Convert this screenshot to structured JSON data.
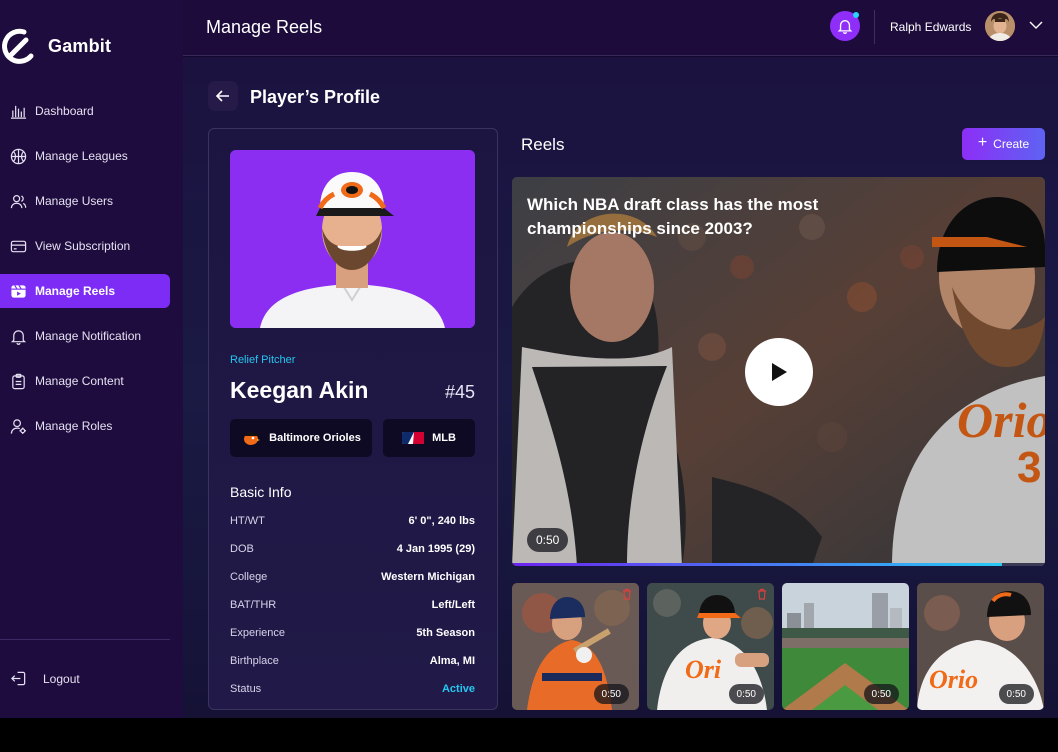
{
  "app": {
    "name": "Gambit"
  },
  "header": {
    "title": "Manage Reels",
    "user_name": "Ralph Edwards"
  },
  "sidebar": {
    "items": [
      {
        "label": "Dashboard",
        "icon": "bar-chart-icon",
        "active": false
      },
      {
        "label": "Manage Leagues",
        "icon": "basketball-icon",
        "active": false
      },
      {
        "label": "Manage Users",
        "icon": "users-icon",
        "active": false
      },
      {
        "label": "View Subscription",
        "icon": "credit-card-icon",
        "active": false
      },
      {
        "label": "Manage Reels",
        "icon": "reels-icon",
        "active": true
      },
      {
        "label": "Manage Notification",
        "icon": "bell-icon",
        "active": false
      },
      {
        "label": "Manage Content",
        "icon": "clipboard-icon",
        "active": false
      },
      {
        "label": "Manage Roles",
        "icon": "user-cog-icon",
        "active": false
      }
    ],
    "logout_label": "Logout"
  },
  "profile": {
    "section_title": "Player’s Profile",
    "position": "Relief Pitcher",
    "name": "Keegan Akin",
    "number": "#45",
    "team": "Baltimore Orioles",
    "league": "MLB",
    "basic_info_title": "Basic Info",
    "info": [
      {
        "label": "HT/WT",
        "value": "6' 0\", 240 lbs"
      },
      {
        "label": "DOB",
        "value": "4 Jan 1995 (29)"
      },
      {
        "label": "College",
        "value": "Western Michigan"
      },
      {
        "label": "BAT/THR",
        "value": "Left/Left"
      },
      {
        "label": "Experience",
        "value": "5th Season"
      },
      {
        "label": "Birthplace",
        "value": "Alma, MI"
      },
      {
        "label": "Status",
        "value": "Active"
      }
    ]
  },
  "reels": {
    "title": "Reels",
    "create_label": "Create",
    "featured": {
      "question": "Which NBA draft class has the most championships since 2003?",
      "duration": "0:50",
      "progress": 0.92
    },
    "thumbnails": [
      {
        "duration": "0:50"
      },
      {
        "duration": "0:50"
      },
      {
        "duration": "0:50"
      },
      {
        "duration": "0:50"
      }
    ]
  },
  "colors": {
    "accent": "#7c2cf5",
    "cyan": "#26c7f2",
    "sidebar": "#1d0c3d"
  }
}
